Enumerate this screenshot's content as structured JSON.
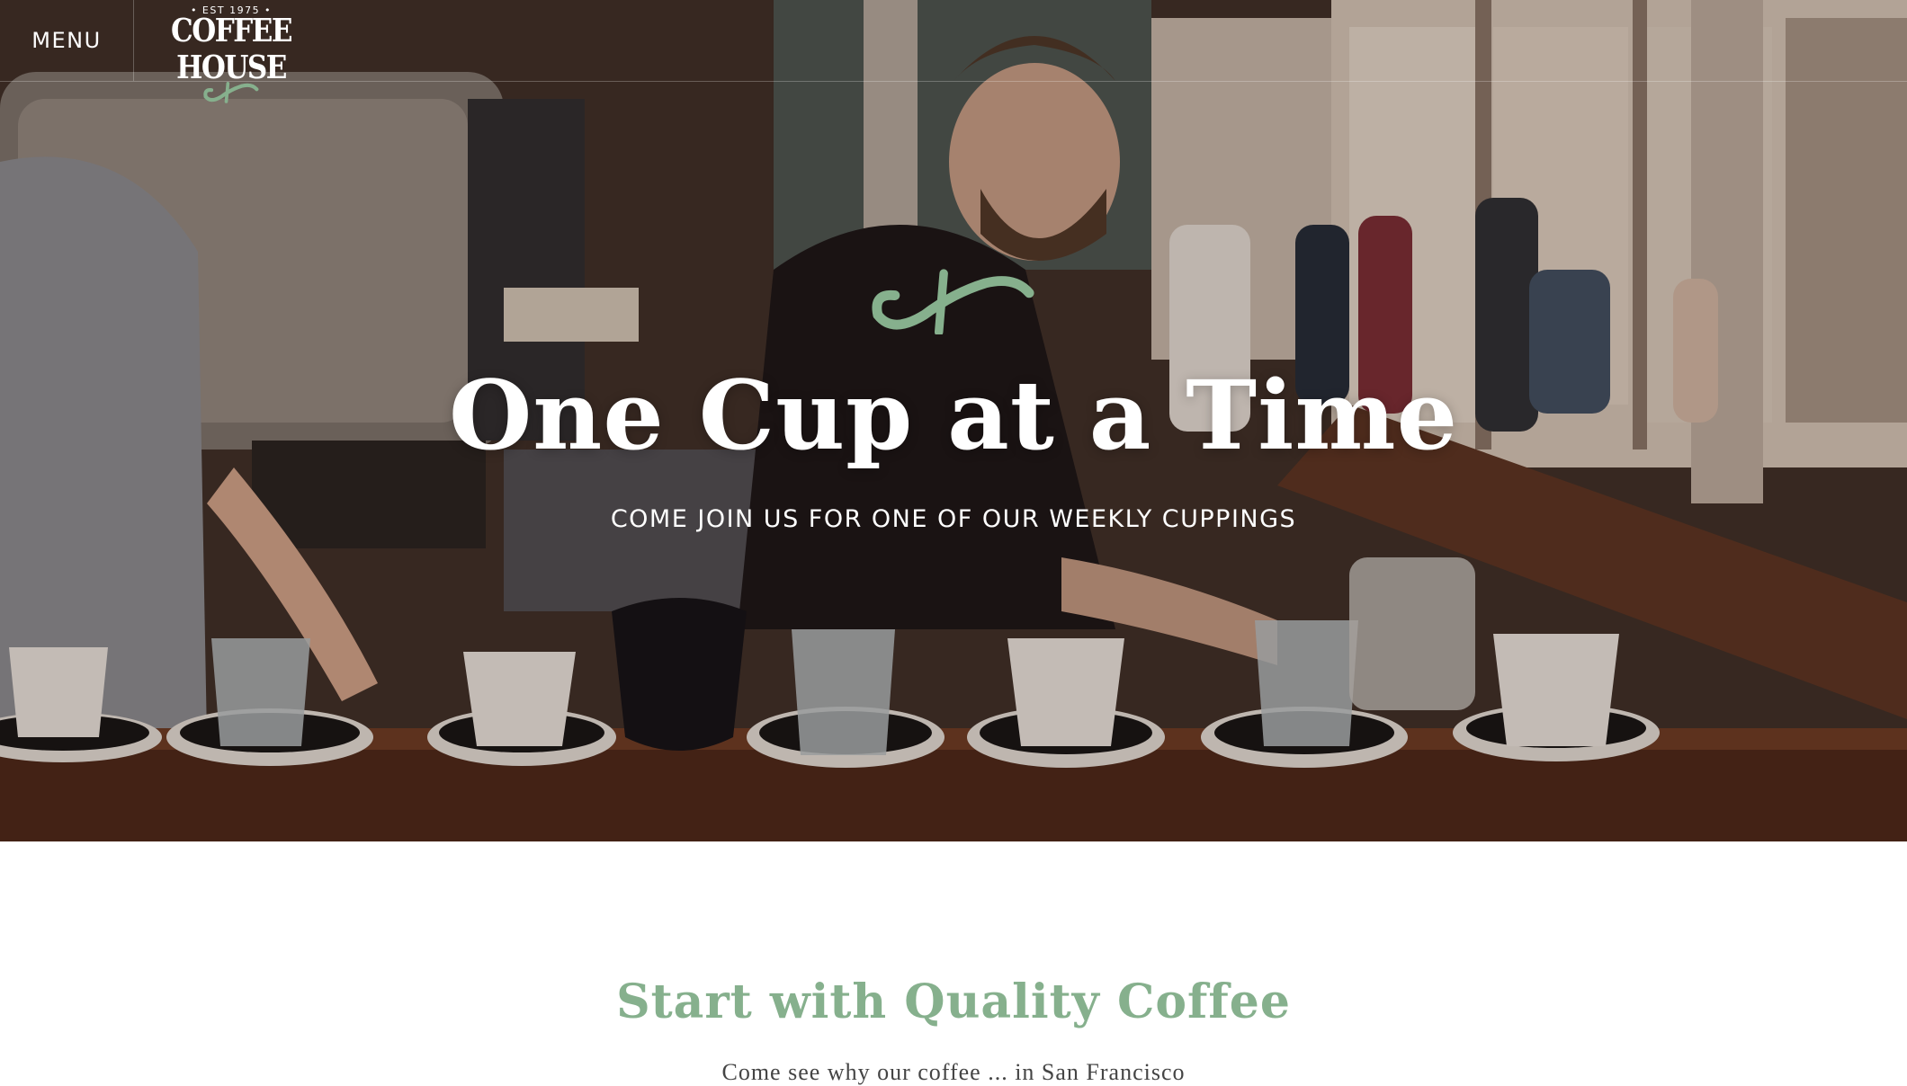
{
  "nav": {
    "menu_label": "MENU",
    "logo": {
      "est_text": "• EST 1975 •",
      "name": "COFFEE HOUSE",
      "icon": "coffee-leaf-mark"
    }
  },
  "hero": {
    "icon": "coffee-leaf-mark",
    "title": "One Cup at a Time",
    "subtitle": "COME JOIN US FOR ONE OF OUR WEEKLY CUPPINGS"
  },
  "section": {
    "title": "Start with Quality Coffee",
    "text": "Come see why our coffee ... in San Francisco"
  },
  "colors": {
    "accent_green": "#86b08d",
    "text_white": "#ffffff"
  }
}
